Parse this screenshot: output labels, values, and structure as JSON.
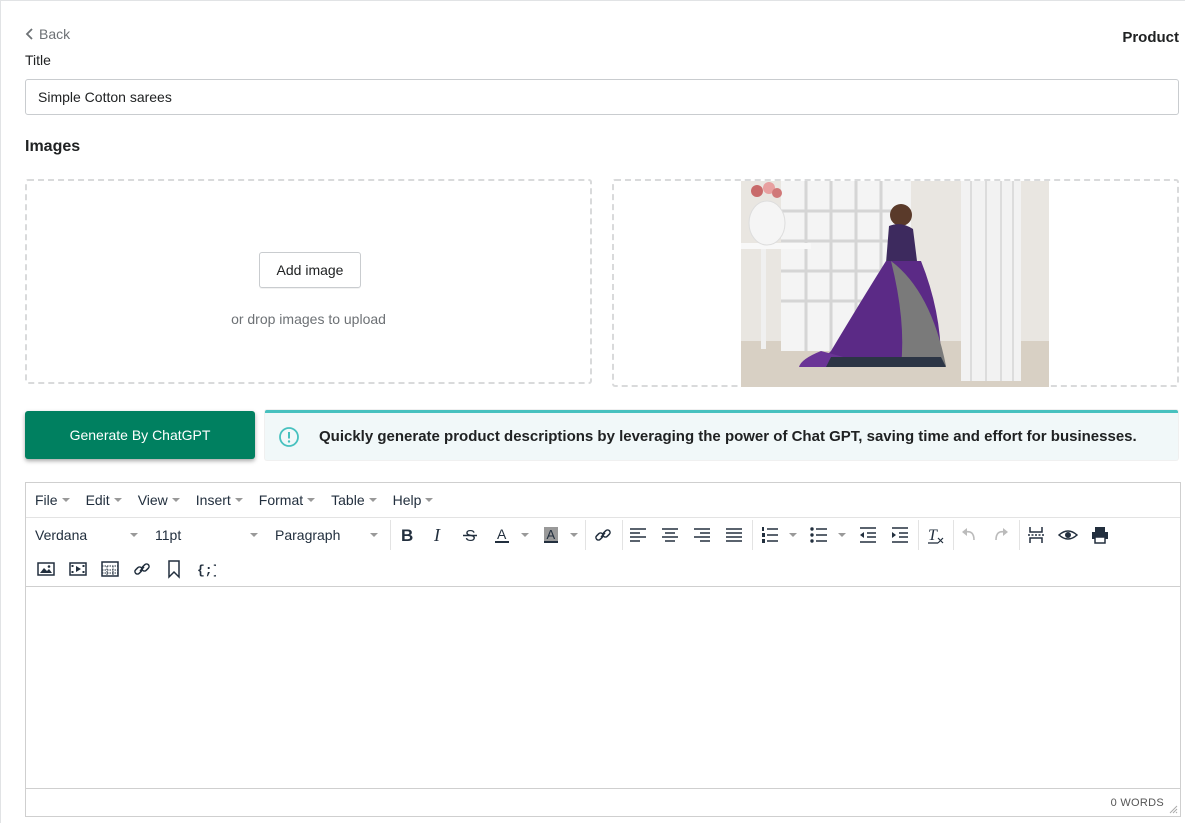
{
  "header": {
    "back_label": "Back",
    "page_title": "Product"
  },
  "form": {
    "title_label": "Title",
    "title_value": "Simple Cotton sarees"
  },
  "images": {
    "section_title": "Images",
    "add_button": "Add image",
    "drop_hint": "or drop images to upload",
    "photo_alt": "Woman in purple silk saree seated by window"
  },
  "generate": {
    "button_label": "Generate By ChatGPT",
    "banner_text": "Quickly generate product descriptions by leveraging the power of Chat GPT, saving time and effort for businesses."
  },
  "editor": {
    "menus": [
      "File",
      "Edit",
      "View",
      "Insert",
      "Format",
      "Table",
      "Help"
    ],
    "font_family": "Verdana",
    "font_size": "11pt",
    "block_format": "Paragraph",
    "word_count": "0 WORDS"
  },
  "colors": {
    "primary": "#008060",
    "banner_accent": "#47c1bf",
    "banner_bg": "#f1f8f9"
  }
}
